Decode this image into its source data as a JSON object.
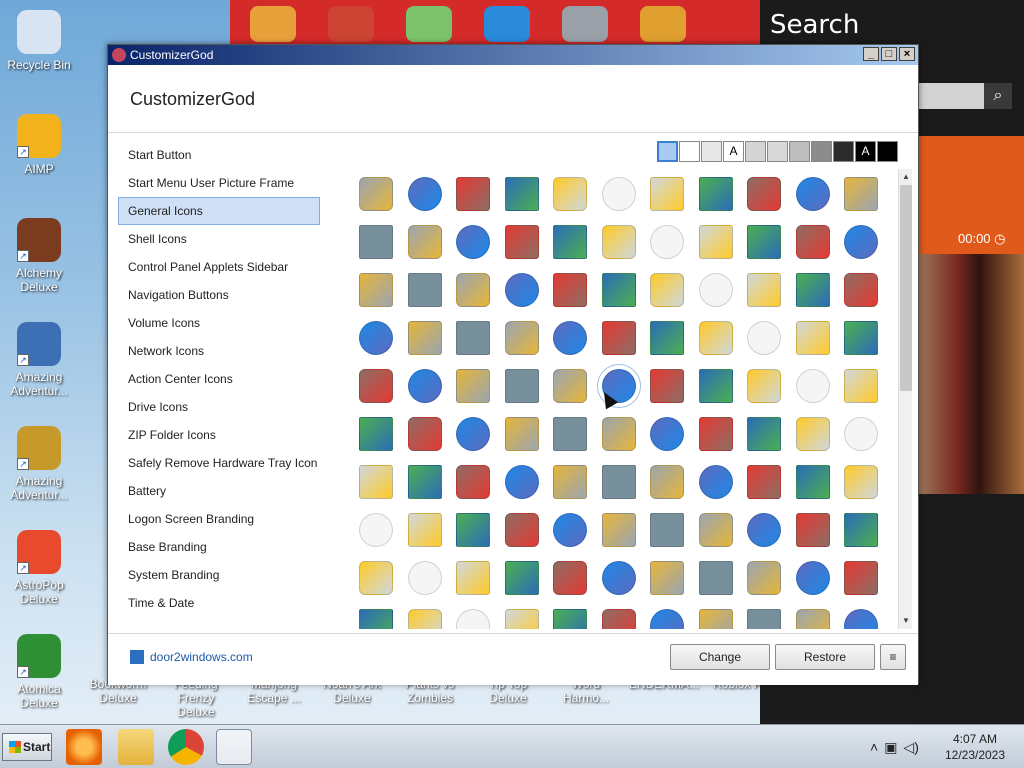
{
  "desktop": {
    "icons": [
      {
        "label": "Recycle Bin",
        "icon": "recycle-bin-icon",
        "color": "#d8e4f2"
      },
      {
        "label": "AIMP",
        "icon": "aimp-icon",
        "color": "#f2b21b"
      },
      {
        "label": "Alchemy Deluxe",
        "icon": "alchemy-icon",
        "color": "#7a3b1e"
      },
      {
        "label": "Amazing Adventur...",
        "icon": "amazing-adventures-icon",
        "color": "#3d6fb5"
      },
      {
        "label": "Amazing Adventur...",
        "icon": "amazing-adventures-2-icon",
        "color": "#c59a2b"
      },
      {
        "label": "AstroPop Deluxe",
        "icon": "astropop-icon",
        "color": "#e84a2d"
      },
      {
        "label": "Atomica Deluxe",
        "icon": "atomica-icon",
        "color": "#2f8f35"
      }
    ],
    "bottom_row_labels": [
      "Bookworm Deluxe",
      "Feeding Frenzy Deluxe",
      "Mahjong Escape ...",
      "Noah's Ark Deluxe",
      "Plants vs Zombies",
      "Tip Top Deluxe",
      "Word Harmo...",
      "ENDERMA...",
      "Roblox Pla"
    ]
  },
  "search_panel": {
    "title": "Search",
    "search_icon": "magnifier-icon",
    "media_time": "00:00"
  },
  "window": {
    "title": "CustomizerGod",
    "header_title": "CustomizerGod",
    "sidebar_items": [
      "Start Button",
      "Start Menu User Picture Frame",
      "General Icons",
      "Shell Icons",
      "Control Panel Applets Sidebar",
      "Navigation Buttons",
      "Volume Icons",
      "Network Icons",
      "Action Center Icons",
      "Drive Icons",
      "ZIP Folder Icons",
      "Safely Remove Hardware Tray Icon",
      "Battery",
      "Logon Screen Branding",
      "Base Branding",
      "System Branding",
      "Time & Date"
    ],
    "selected_item": "General Icons",
    "swatches": [
      {
        "bg": "#a6caf0",
        "text": "",
        "selected": true
      },
      {
        "bg": "#ffffff",
        "text": ""
      },
      {
        "bg": "#e8e8e8",
        "text": ""
      },
      {
        "bg": "#ffffff",
        "text": "A"
      },
      {
        "bg": "#d4d4d4",
        "text": ""
      },
      {
        "bg": "#d9d9d9",
        "text": ""
      },
      {
        "bg": "#bdbdbd",
        "text": ""
      },
      {
        "bg": "#8c8c8c",
        "text": ""
      },
      {
        "bg": "#2b2b2b",
        "text": ""
      },
      {
        "bg": "#000000",
        "text": "A"
      },
      {
        "bg": "#000000",
        "text": ""
      }
    ],
    "footer_link": "door2windows.com",
    "change_label": "Change",
    "restore_label": "Restore",
    "menu_label": "≡"
  },
  "taskbar": {
    "start_label": "Start",
    "apps": [
      "firefox-icon",
      "explorer-icon",
      "chrome-icon",
      "customizergod-icon"
    ],
    "time": "4:07 AM",
    "date": "12/23/2023"
  }
}
